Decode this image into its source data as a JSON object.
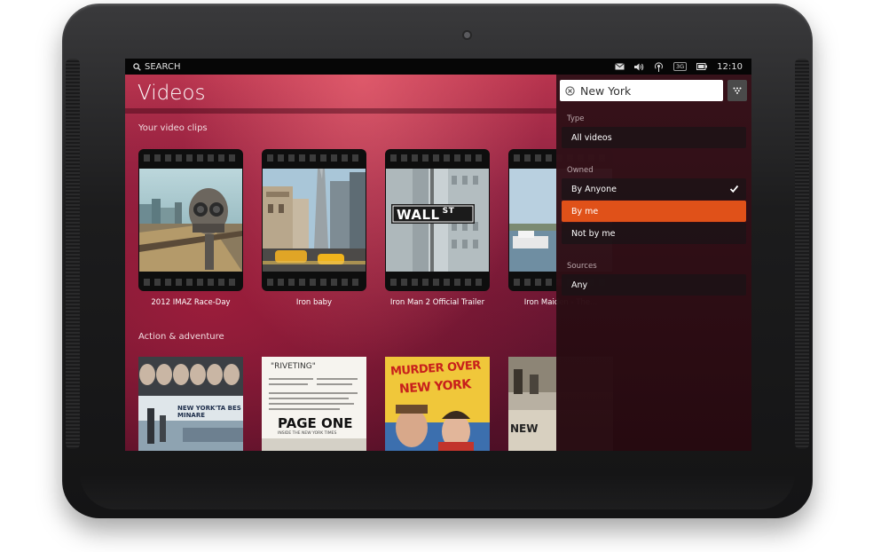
{
  "status_bar": {
    "search_label": "SEARCH",
    "time": "12:10",
    "network_label": "3G",
    "indicator_icons": [
      "envelope-icon",
      "volume-icon",
      "signal-icon",
      "network-icon",
      "battery-icon"
    ]
  },
  "app": {
    "title": "Videos"
  },
  "sections": {
    "video_clips": {
      "title": "Your video clips",
      "items": [
        {
          "caption": "2012 IMAZ Race-Day"
        },
        {
          "caption": "Iron baby"
        },
        {
          "caption": "Iron Man 2 Official Trailer"
        },
        {
          "caption": "Iron Maiden - The..."
        }
      ]
    },
    "action": {
      "title": "Action & adventure",
      "posters": [
        {
          "title": "NEW YORK'TA BES MINARE"
        },
        {
          "quote": "\"RIVETING\"",
          "title": "PAGE ONE",
          "subtitle": "INSIDE THE NEW YORK TIMES"
        },
        {
          "title_line1": "MURDER OVER",
          "title_line2": "NEW YORK"
        },
        {
          "title": "NEW"
        }
      ]
    },
    "street_sign": {
      "text": "WALL",
      "suffix": "ST"
    }
  },
  "filter_panel": {
    "search": {
      "value": "New York",
      "placeholder": ""
    },
    "type_label": "Type",
    "type_options": [
      "All videos"
    ],
    "owned_label": "Owned",
    "owned_options": [
      "By Anyone",
      "By me",
      "Not by me"
    ],
    "owned_checked": "By Anyone",
    "owned_highlighted": "By me",
    "sources_label": "Sources",
    "sources_options": [
      "Any"
    ]
  },
  "colors": {
    "accent": "#e05119",
    "background": "#8c2040",
    "panel": "#2a0c14",
    "text": "#ffffff"
  }
}
